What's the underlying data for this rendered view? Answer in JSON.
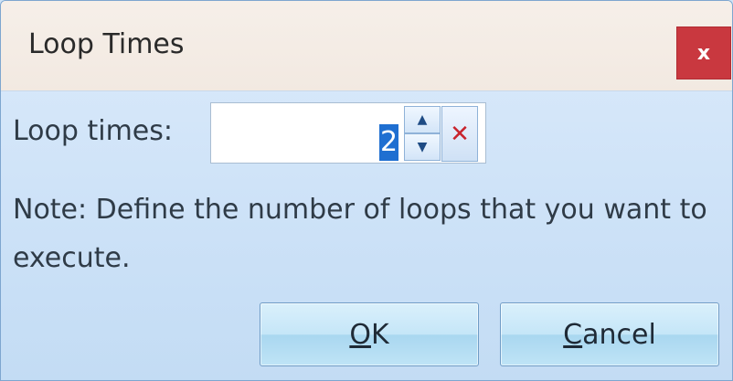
{
  "window": {
    "title": "Loop Times",
    "close_label": "x"
  },
  "form": {
    "loop_label": "Loop times:",
    "loop_value": "2",
    "spin_up_glyph": "▲",
    "spin_down_glyph": "▼",
    "clear_glyph": "✕"
  },
  "note": {
    "text": "Note: Define the number of loops that you want to execute."
  },
  "buttons": {
    "ok_mnemonic": "O",
    "ok_rest": "K",
    "cancel_mnemonic": "C",
    "cancel_rest": "ancel"
  },
  "colors": {
    "close_button": "#c9383f",
    "selection": "#1f6fd1",
    "clear_icon": "#c8242d"
  },
  "icons": {
    "close": "close-icon",
    "spin_up": "arrow-up-icon",
    "spin_down": "arrow-down-icon",
    "clear": "clear-x-icon"
  }
}
